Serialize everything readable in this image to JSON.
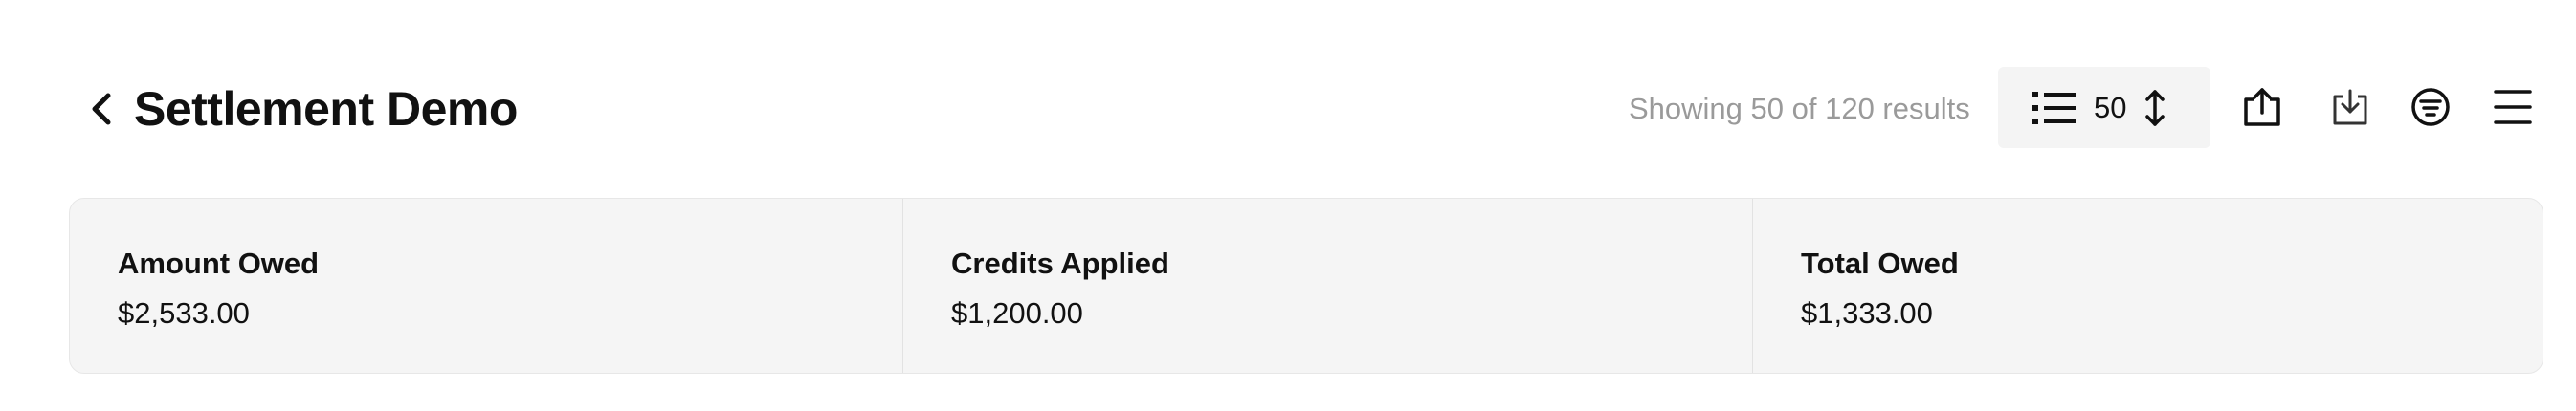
{
  "header": {
    "title": "Settlement Demo",
    "results_text": "Showing 50 of 120 results",
    "page_size": "50",
    "icons": {
      "back": "chevron-left-icon",
      "page_size_list": "list-icon",
      "page_size_toggle": "up-down-arrows-icon",
      "export": "upload-icon",
      "import": "download-icon",
      "filter": "filter-icon",
      "menu": "hamburger-menu-icon"
    }
  },
  "summary": {
    "items": [
      {
        "label": "Amount Owed",
        "value": "$2,533.00"
      },
      {
        "label": "Credits Applied",
        "value": "$1,200.00"
      },
      {
        "label": "Total Owed",
        "value": "$1,333.00"
      }
    ]
  },
  "colors": {
    "text": "#111111",
    "muted_text": "#9a9a9a",
    "card_background": "#f5f5f5",
    "card_border": "#e7e7e7",
    "page_size_background": "#f4f4f4"
  }
}
